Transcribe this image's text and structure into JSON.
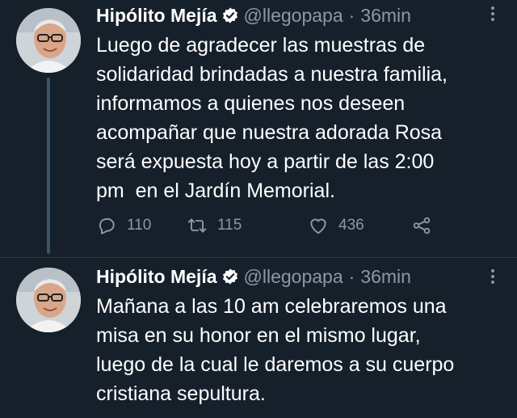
{
  "colors": {
    "background": "#15202b",
    "text": "#ffffff",
    "muted": "#8b98a5",
    "verified": "#ffffff"
  },
  "tweets": [
    {
      "author_name": "Hipólito Mejía",
      "handle": "@llegopapa",
      "separator": "·",
      "time": "36min",
      "text": "Luego de agradecer las muestras de\nsolidaridad brindadas a nuestra familia,\ninformamos a quienes nos deseen\nacompañar que nuestra adorada Rosa\nserá expuesta hoy a partir de las 2:00\npm  en el Jardín Memorial.",
      "replies": "110",
      "retweets": "115",
      "likes": "436"
    },
    {
      "author_name": "Hipólito Mejía",
      "handle": "@llegopapa",
      "separator": "·",
      "time": "36min",
      "text": "Mañana a las 10 am celebraremos una\nmisa en su honor en el mismo lugar,\nluego de la cual le daremos a su cuerpo\ncristiana sepultura."
    }
  ],
  "icons": {
    "verified": "verified-badge-icon",
    "more": "more-options-icon",
    "reply": "reply-icon",
    "retweet": "retweet-icon",
    "like": "heart-icon",
    "share": "share-icon"
  }
}
